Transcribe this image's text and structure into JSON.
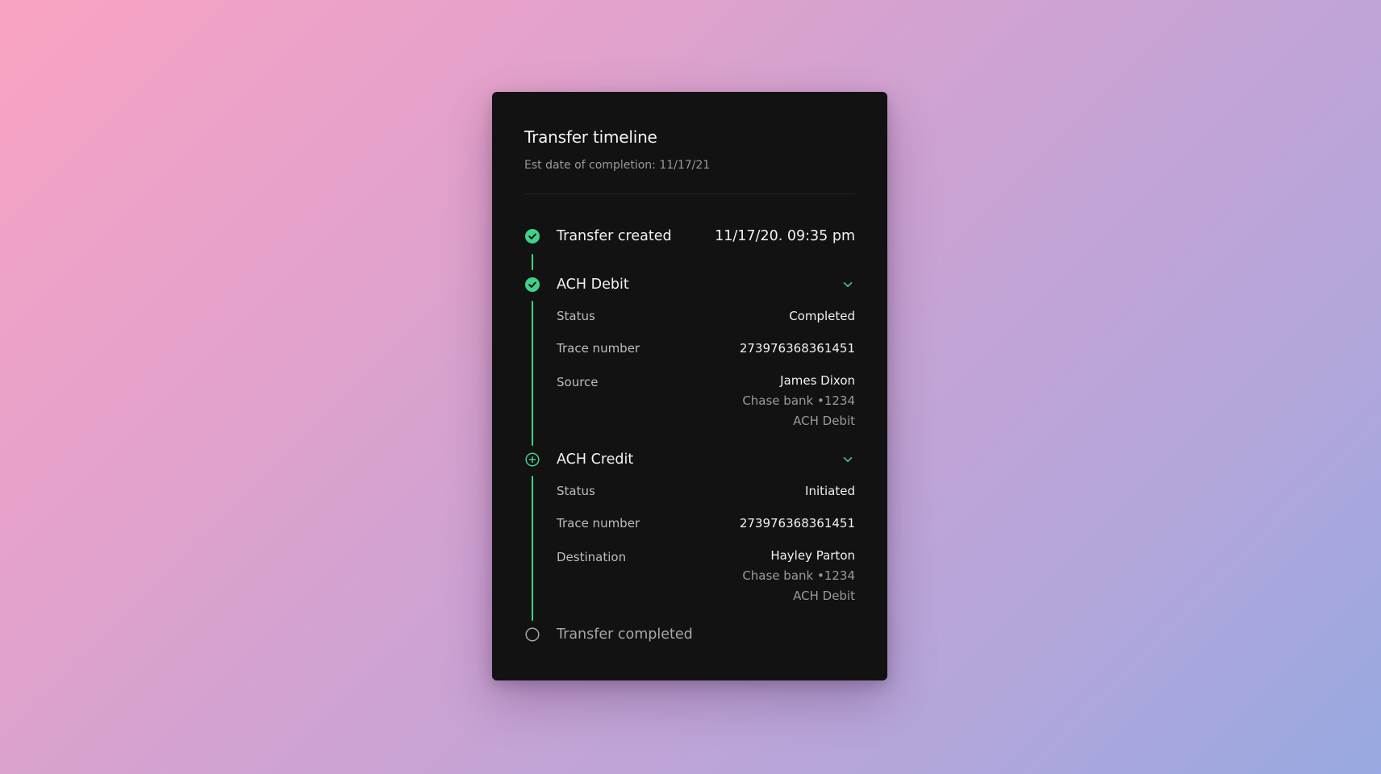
{
  "header": {
    "title": "Transfer timeline",
    "subtitle": "Est date of completion: 11/17/21"
  },
  "steps": [
    {
      "label": "Transfer created",
      "timestamp": "11/17/20. 09:35 pm",
      "state": "done"
    },
    {
      "label": "ACH Debit",
      "state": "done",
      "details": {
        "status_key": "Status",
        "status_value": "Completed",
        "trace_key": "Trace number",
        "trace_value": "273976368361451",
        "party_key": "Source",
        "party_name": "James Dixon",
        "party_bank": "Chase bank •1234",
        "party_method": "ACH Debit"
      }
    },
    {
      "label": "ACH Credit",
      "state": "in-progress",
      "details": {
        "status_key": "Status",
        "status_value": "Initiated",
        "trace_key": "Trace number",
        "trace_value": "273976368361451",
        "party_key": "Destination",
        "party_name": "Hayley Parton",
        "party_bank": "Chase bank •1234",
        "party_method": "ACH Debit"
      }
    },
    {
      "label": "Transfer completed",
      "state": "pending"
    }
  ],
  "colors": {
    "accent": "#3fd18b",
    "card": "#121212",
    "muted_text": "#9a9a9a"
  },
  "icons": {
    "done": "check-circle-icon",
    "in_progress": "plus-circle-icon",
    "pending": "empty-circle-icon",
    "expand": "chevron-down-icon"
  }
}
